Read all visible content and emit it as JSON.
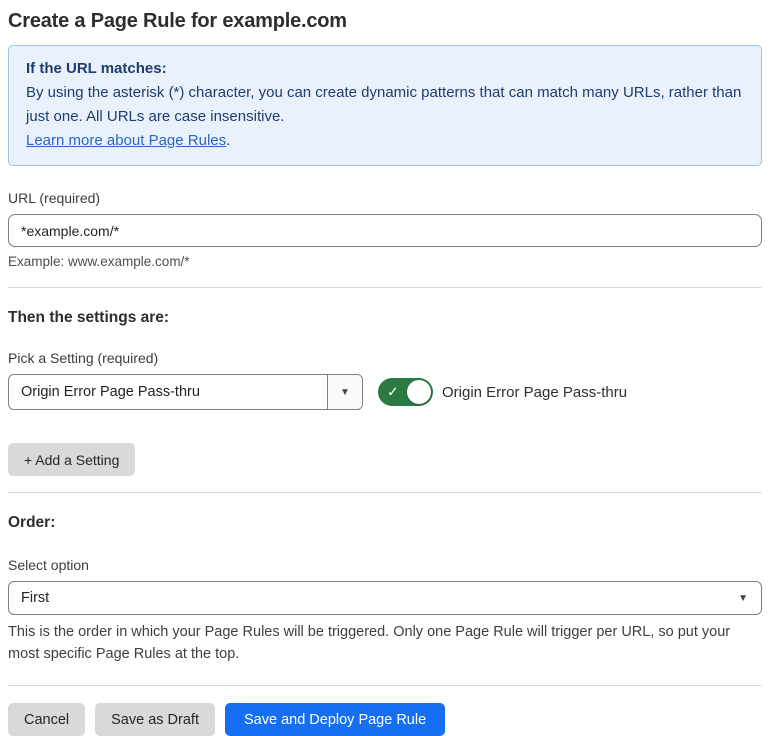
{
  "page": {
    "title": "Create a Page Rule for example.com"
  },
  "info_box": {
    "heading": "If the URL matches:",
    "body": "By using the asterisk (*) character, you can create dynamic patterns that can match many URLs, rather than just one. All URLs are case insensitive.",
    "link_label": "Learn more about Page Rules",
    "link_suffix": "."
  },
  "url_field": {
    "label": "URL (required)",
    "value": "*example.com/*",
    "example": "Example: www.example.com/*"
  },
  "settings_section": {
    "heading": "Then the settings are:",
    "picker_label": "Pick a Setting (required)",
    "selected_setting": "Origin Error Page Pass-thru",
    "toggle_state": "on",
    "toggle_label": "Origin Error Page Pass-thru",
    "add_button_label": "+ Add a Setting"
  },
  "order_section": {
    "heading": "Order:",
    "select_label": "Select option",
    "selected_option": "First",
    "description": "This is the order in which your Page Rules will be triggered. Only one Page Rule will trigger per URL, so put your most specific Page Rules at the top."
  },
  "footer": {
    "cancel_label": "Cancel",
    "save_draft_label": "Save as Draft",
    "save_deploy_label": "Save and Deploy Page Rule"
  },
  "icons": {
    "dropdown_arrow": "▼",
    "toggle_check": "✓"
  },
  "colors": {
    "info_bg": "#e9f2fc",
    "info_border": "#9cc0e7",
    "info_text": "#1f3c6d",
    "link_blue": "#2a66c2",
    "toggle_green": "#2b7a41",
    "primary_blue": "#156ff0",
    "button_gray": "#d9d9d9"
  }
}
